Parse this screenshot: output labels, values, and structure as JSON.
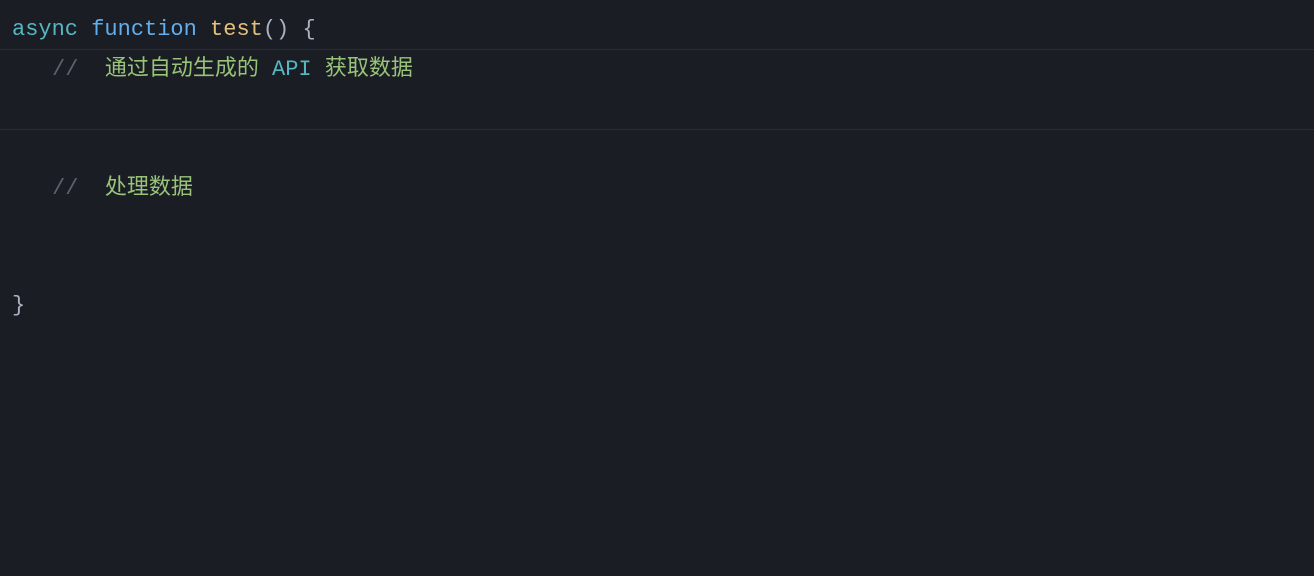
{
  "editor": {
    "background": "#1a1d23",
    "lines": [
      {
        "id": "line1",
        "tokens": [
          {
            "type": "async",
            "text": "async"
          },
          {
            "type": "space",
            "text": " "
          },
          {
            "type": "function",
            "text": "function"
          },
          {
            "type": "space",
            "text": " "
          },
          {
            "type": "name",
            "text": "test"
          },
          {
            "type": "paren",
            "text": "()"
          },
          {
            "type": "space",
            "text": " "
          },
          {
            "type": "brace",
            "text": "{"
          }
        ],
        "border": true
      },
      {
        "id": "line2",
        "tokens": [
          {
            "type": "indent"
          },
          {
            "type": "comment-slash",
            "text": "//"
          },
          {
            "type": "space",
            "text": "  "
          },
          {
            "type": "comment-text",
            "text": "通过自动生成的"
          },
          {
            "type": "space",
            "text": " "
          },
          {
            "type": "comment-api",
            "text": "API"
          },
          {
            "type": "space",
            "text": " "
          },
          {
            "type": "comment-text",
            "text": "获取数据"
          }
        ],
        "border": false
      },
      {
        "id": "line3",
        "tokens": [],
        "border": true
      },
      {
        "id": "line4",
        "tokens": [],
        "border": false
      },
      {
        "id": "line5",
        "tokens": [
          {
            "type": "indent"
          },
          {
            "type": "comment-slash",
            "text": "//"
          },
          {
            "type": "space",
            "text": "  "
          },
          {
            "type": "comment-text",
            "text": "处理数据"
          }
        ],
        "border": false
      },
      {
        "id": "line6",
        "tokens": [],
        "border": false
      },
      {
        "id": "line7",
        "tokens": [],
        "border": false
      },
      {
        "id": "line8",
        "tokens": [
          {
            "type": "brace",
            "text": "}"
          }
        ],
        "border": false
      }
    ]
  }
}
